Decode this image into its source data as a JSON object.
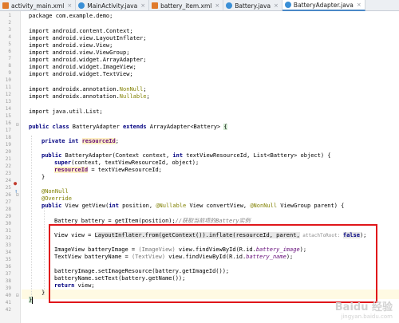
{
  "tabs": [
    {
      "label": "activity_main.xml",
      "type": "xml",
      "active": false
    },
    {
      "label": "MainActivity.java",
      "type": "java",
      "active": false
    },
    {
      "label": "battery_item.xml",
      "type": "xml",
      "active": false
    },
    {
      "label": "Battery.java",
      "type": "java",
      "active": false
    },
    {
      "label": "BatteryAdapter.java",
      "type": "java",
      "active": true
    }
  ],
  "close_glyph": "×",
  "line_numbers": [
    "1",
    "2",
    "3",
    "4",
    "5",
    "6",
    "7",
    "8",
    "9",
    "10",
    "11",
    "12",
    "13",
    "14",
    "15",
    "16",
    "17",
    "18",
    "19",
    "20",
    "21",
    "22",
    "23",
    "24",
    "25",
    "26",
    "27",
    "28",
    "29",
    "30",
    "31",
    "32",
    "33",
    "34",
    "35",
    "36",
    "37",
    "38",
    "39",
    "40",
    "41",
    "42"
  ],
  "code": {
    "package": "package com.example.demo;",
    "imports": [
      "import android.content.Context;",
      "import android.view.LayoutInflater;",
      "import android.view.View;",
      "import android.view.ViewGroup;",
      "import android.widget.ArrayAdapter;",
      "import android.widget.ImageView;",
      "import android.widget.TextView;"
    ],
    "import_androidx_1_pre": "import androidx.annotation.",
    "import_androidx_1_name": "NonNull",
    "import_androidx_2_name": "Nullable",
    "import_androidx_end": ";",
    "import_list": "import java.util.List;",
    "class_public": "public class",
    "class_name": " BatteryAdapter ",
    "class_extends": "extends",
    "class_rest": " ArrayAdapter<Battery> ",
    "brace_open": "{",
    "brace_close": "}",
    "field_mod": "private int",
    "field_name": "resourceId",
    "semicolon": ";",
    "ctor_public": "public",
    "ctor_name": "BatteryAdapter",
    "ctor_params_1": "(Context context, ",
    "ctor_int": "int",
    "ctor_params_2": " textViewResourceId, List<Battery> object) {",
    "super_kw": "super",
    "super_args": "(context, textViewResourceId, object);",
    "assign_rhs": " = textViewResourceId;",
    "ann_nonnull": "@NonNull",
    "ann_override": "@Override",
    "getview_public": "public",
    "getview_sig_1": " View getView(",
    "getview_sig_2": " position, ",
    "ann_nullable": "@Nullable",
    "getview_sig_3": " View convertView, ",
    "getview_sig_4": " ViewGroup parent) {",
    "battery_line": "Battery battery = getItem(position);",
    "battery_comment": "//获取当前项的Battery实例",
    "view_line_1": "View view = ",
    "view_inflate": "LayoutInflater.from(getContext()).inflate(resourceId, parent,",
    "view_hint": "attachToRoot",
    "view_false": "false",
    "view_end": ");",
    "img_line_1": "ImageView batteryImage = ",
    "img_cast": "(ImageView)",
    "img_line_2": " view.findViewById(R.id.",
    "img_id": "battery_image",
    "txt_line_1": "TextView batteryName = ",
    "txt_cast": "(TextView)",
    "txt_line_2": " view.findViewById(R.id.",
    "txt_id": "battery_name",
    "paren_semi": ");",
    "set_image": "batteryImage.setImageResource(battery.getImageId());",
    "set_text": "batteryName.setText(battery.getName());",
    "return_kw": "return",
    "return_rest": " view;"
  },
  "watermark": {
    "title": "Baidu 经验",
    "url": "jingyan.baidu.com"
  },
  "colors": {
    "keyword": "#000080",
    "field": "#660e7a",
    "annotation": "#808000",
    "comment": "#808080",
    "highlight_box": "#e0161a",
    "active_tab_underline": "#4a88c7"
  }
}
